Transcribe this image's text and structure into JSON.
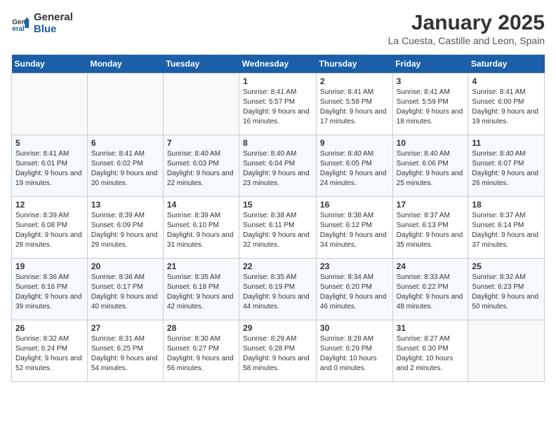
{
  "header": {
    "logo_line1": "General",
    "logo_line2": "Blue",
    "title": "January 2025",
    "subtitle": "La Cuesta, Castille and Leon, Spain"
  },
  "days_of_week": [
    "Sunday",
    "Monday",
    "Tuesday",
    "Wednesday",
    "Thursday",
    "Friday",
    "Saturday"
  ],
  "weeks": [
    [
      {
        "day": "",
        "info": ""
      },
      {
        "day": "",
        "info": ""
      },
      {
        "day": "",
        "info": ""
      },
      {
        "day": "1",
        "info": "Sunrise: 8:41 AM\nSunset: 5:57 PM\nDaylight: 9 hours and 16 minutes."
      },
      {
        "day": "2",
        "info": "Sunrise: 8:41 AM\nSunset: 5:58 PM\nDaylight: 9 hours and 17 minutes."
      },
      {
        "day": "3",
        "info": "Sunrise: 8:41 AM\nSunset: 5:59 PM\nDaylight: 9 hours and 18 minutes."
      },
      {
        "day": "4",
        "info": "Sunrise: 8:41 AM\nSunset: 6:00 PM\nDaylight: 9 hours and 19 minutes."
      }
    ],
    [
      {
        "day": "5",
        "info": "Sunrise: 8:41 AM\nSunset: 6:01 PM\nDaylight: 9 hours and 19 minutes."
      },
      {
        "day": "6",
        "info": "Sunrise: 8:41 AM\nSunset: 6:02 PM\nDaylight: 9 hours and 20 minutes."
      },
      {
        "day": "7",
        "info": "Sunrise: 8:40 AM\nSunset: 6:03 PM\nDaylight: 9 hours and 22 minutes."
      },
      {
        "day": "8",
        "info": "Sunrise: 8:40 AM\nSunset: 6:04 PM\nDaylight: 9 hours and 23 minutes."
      },
      {
        "day": "9",
        "info": "Sunrise: 8:40 AM\nSunset: 6:05 PM\nDaylight: 9 hours and 24 minutes."
      },
      {
        "day": "10",
        "info": "Sunrise: 8:40 AM\nSunset: 6:06 PM\nDaylight: 9 hours and 25 minutes."
      },
      {
        "day": "11",
        "info": "Sunrise: 8:40 AM\nSunset: 6:07 PM\nDaylight: 9 hours and 26 minutes."
      }
    ],
    [
      {
        "day": "12",
        "info": "Sunrise: 8:39 AM\nSunset: 6:08 PM\nDaylight: 9 hours and 28 minutes."
      },
      {
        "day": "13",
        "info": "Sunrise: 8:39 AM\nSunset: 6:09 PM\nDaylight: 9 hours and 29 minutes."
      },
      {
        "day": "14",
        "info": "Sunrise: 8:39 AM\nSunset: 6:10 PM\nDaylight: 9 hours and 31 minutes."
      },
      {
        "day": "15",
        "info": "Sunrise: 8:38 AM\nSunset: 6:11 PM\nDaylight: 9 hours and 32 minutes."
      },
      {
        "day": "16",
        "info": "Sunrise: 8:38 AM\nSunset: 6:12 PM\nDaylight: 9 hours and 34 minutes."
      },
      {
        "day": "17",
        "info": "Sunrise: 8:37 AM\nSunset: 6:13 PM\nDaylight: 9 hours and 35 minutes."
      },
      {
        "day": "18",
        "info": "Sunrise: 8:37 AM\nSunset: 6:14 PM\nDaylight: 9 hours and 37 minutes."
      }
    ],
    [
      {
        "day": "19",
        "info": "Sunrise: 8:36 AM\nSunset: 6:16 PM\nDaylight: 9 hours and 39 minutes."
      },
      {
        "day": "20",
        "info": "Sunrise: 8:36 AM\nSunset: 6:17 PM\nDaylight: 9 hours and 40 minutes."
      },
      {
        "day": "21",
        "info": "Sunrise: 8:35 AM\nSunset: 6:18 PM\nDaylight: 9 hours and 42 minutes."
      },
      {
        "day": "22",
        "info": "Sunrise: 8:35 AM\nSunset: 6:19 PM\nDaylight: 9 hours and 44 minutes."
      },
      {
        "day": "23",
        "info": "Sunrise: 8:34 AM\nSunset: 6:20 PM\nDaylight: 9 hours and 46 minutes."
      },
      {
        "day": "24",
        "info": "Sunrise: 8:33 AM\nSunset: 6:22 PM\nDaylight: 9 hours and 48 minutes."
      },
      {
        "day": "25",
        "info": "Sunrise: 8:32 AM\nSunset: 6:23 PM\nDaylight: 9 hours and 50 minutes."
      }
    ],
    [
      {
        "day": "26",
        "info": "Sunrise: 8:32 AM\nSunset: 6:24 PM\nDaylight: 9 hours and 52 minutes."
      },
      {
        "day": "27",
        "info": "Sunrise: 8:31 AM\nSunset: 6:25 PM\nDaylight: 9 hours and 54 minutes."
      },
      {
        "day": "28",
        "info": "Sunrise: 8:30 AM\nSunset: 6:27 PM\nDaylight: 9 hours and 56 minutes."
      },
      {
        "day": "29",
        "info": "Sunrise: 8:29 AM\nSunset: 6:28 PM\nDaylight: 9 hours and 58 minutes."
      },
      {
        "day": "30",
        "info": "Sunrise: 8:28 AM\nSunset: 6:29 PM\nDaylight: 10 hours and 0 minutes."
      },
      {
        "day": "31",
        "info": "Sunrise: 8:27 AM\nSunset: 6:30 PM\nDaylight: 10 hours and 2 minutes."
      },
      {
        "day": "",
        "info": ""
      }
    ]
  ]
}
